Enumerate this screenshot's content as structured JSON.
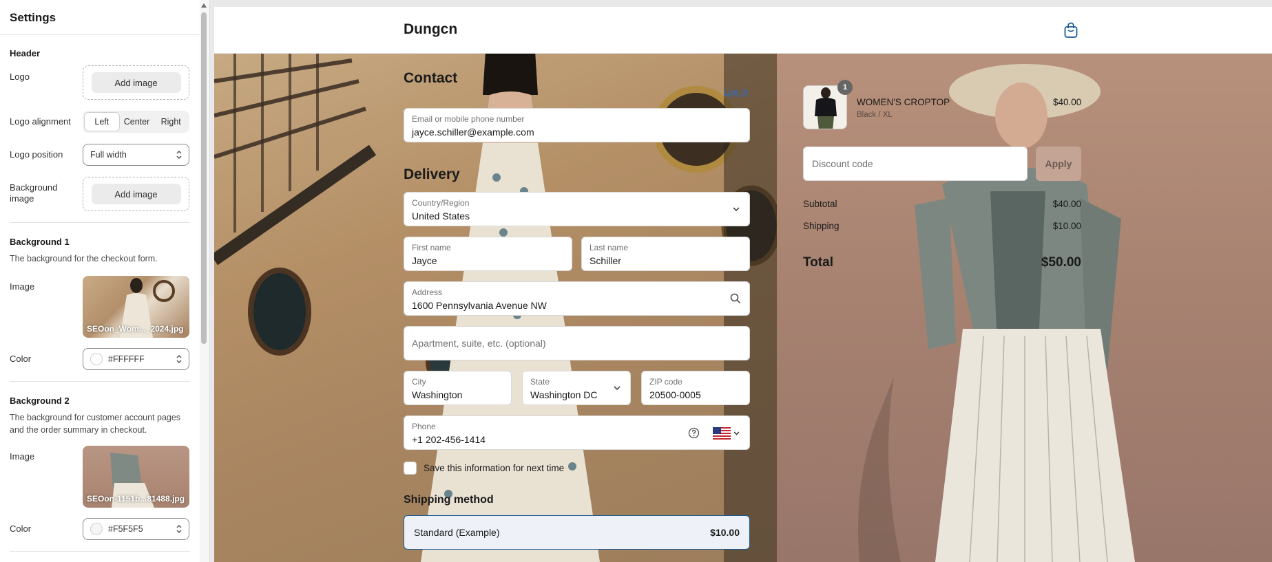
{
  "settings": {
    "title": "Settings",
    "header_section": "Header",
    "logo_label": "Logo",
    "logo_button": "Add image",
    "logo_alignment_label": "Logo alignment",
    "alignment_options": [
      "Left",
      "Center",
      "Right"
    ],
    "alignment_selected": "Left",
    "logo_position_label": "Logo position",
    "logo_position_value": "Full width",
    "background_image_label": "Background image",
    "background_image_button": "Add image",
    "bg1": {
      "title": "Background 1",
      "description": "The background for the checkout form.",
      "image_label": "Image",
      "image_caption": "SEOon_Wom..._2024.jpg",
      "color_label": "Color",
      "color_value": "#FFFFFF"
    },
    "bg2": {
      "title": "Background 2",
      "description": "The background for customer account pages and the order summary in checkout.",
      "image_label": "Image",
      "image_caption": "SEOon-1151b...81488.jpg",
      "color_label": "Color",
      "color_value": "#F5F5F5"
    }
  },
  "store": {
    "name": "Dungcn",
    "icon": "shopping-bag-icon"
  },
  "contact": {
    "heading": "Contact",
    "login_link": "Log in",
    "email_label": "Email or mobile phone number",
    "email_value": "jayce.schiller@example.com"
  },
  "delivery": {
    "heading": "Delivery",
    "country_label": "Country/Region",
    "country_value": "United States",
    "first_name_label": "First name",
    "first_name_value": "Jayce",
    "last_name_label": "Last name",
    "last_name_value": "Schiller",
    "address_label": "Address",
    "address_value": "1600 Pennsylvania Avenue NW",
    "apartment_placeholder": "Apartment, suite, etc. (optional)",
    "city_label": "City",
    "city_value": "Washington",
    "state_label": "State",
    "state_value": "Washington DC",
    "zip_label": "ZIP code",
    "zip_value": "20500-0005",
    "phone_label": "Phone",
    "phone_value": "+1 202-456-1414",
    "save_info_label": "Save this information for next time"
  },
  "shipping": {
    "heading": "Shipping method",
    "option_name": "Standard (Example)",
    "option_price": "$10.00"
  },
  "summary": {
    "product_qty": "1",
    "product_name": "WOMEN'S CROPTOP",
    "product_variant": "Black / XL",
    "product_price": "$40.00",
    "discount_placeholder": "Discount code",
    "apply_label": "Apply",
    "subtotal_label": "Subtotal",
    "subtotal_value": "$40.00",
    "shipping_label": "Shipping",
    "shipping_value": "$10.00",
    "total_label": "Total",
    "total_value": "$50.00"
  },
  "colors": {
    "accent": "#1a5a92",
    "link": "#2c6ecb",
    "apply_bg": "#c3a495"
  }
}
